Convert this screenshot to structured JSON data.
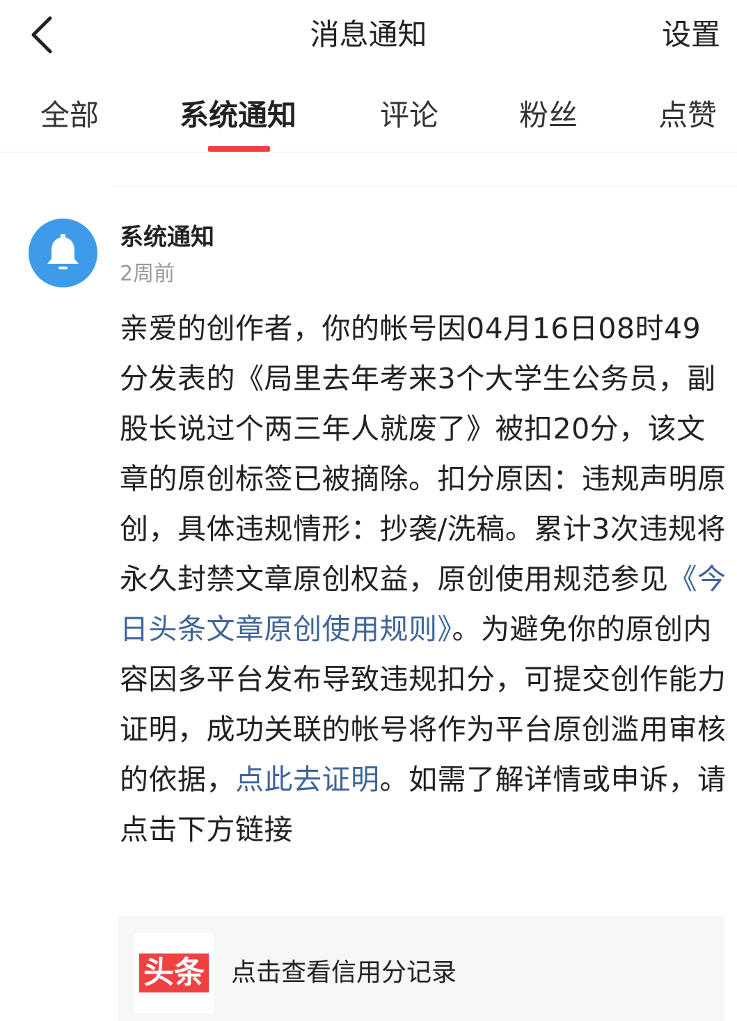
{
  "header": {
    "title": "消息通知",
    "settings_label": "设置",
    "back_icon": "chevron-left-icon"
  },
  "tabs": [
    {
      "label": "全部",
      "active": false
    },
    {
      "label": "系统通知",
      "active": true
    },
    {
      "label": "评论",
      "active": false
    },
    {
      "label": "粉丝",
      "active": false
    },
    {
      "label": "点赞",
      "active": false
    }
  ],
  "accent_color": "#f04142",
  "link_color": "#406599",
  "notification": {
    "avatar_icon": "bell-icon",
    "avatar_color": "#3d9be9",
    "sender": "系统通知",
    "time": "2周前",
    "body_part1": "亲爱的创作者，你的帐号因04月16日08时49分发表的《局里去年考来3个大学生公务员，副股长说过个两三年人就废了》被扣20分，该文章的原创标签已被摘除。扣分原因：违规声明原创，具体违规情形：抄袭/洗稿。累计3次违规将永久封禁文章原创权益，原创使用规范参见",
    "rules_link": "《今日头条文章原创使用规则》",
    "body_part2": "。为避免你的原创内容因多平台发布导致违规扣分，可提交创作能力证明，成功关联的帐号将作为平台原创滥用审核的依据，",
    "prove_link": "点此去证明",
    "body_part3": "。如需了解详情或申诉，请点击下方链接"
  },
  "card": {
    "logo_text": "头条",
    "label": "点击查看信用分记录"
  }
}
